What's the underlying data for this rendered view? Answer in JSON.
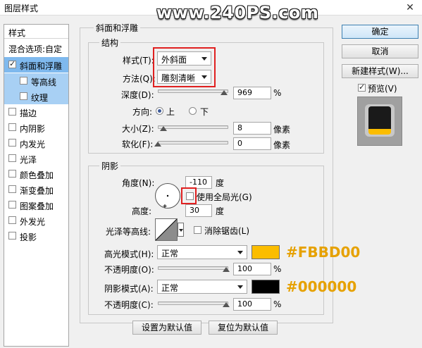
{
  "window": {
    "title": "图层样式",
    "close_glyph": "✕",
    "watermark": "www.240PS.com"
  },
  "left_panel": {
    "header": "样式",
    "blend_options": "混合选项:自定",
    "items": [
      {
        "label": "斜面和浮雕",
        "checked": true
      },
      {
        "label": "等高线",
        "checked": false
      },
      {
        "label": "纹理",
        "checked": false
      },
      {
        "label": "描边",
        "checked": false
      },
      {
        "label": "内阴影",
        "checked": false
      },
      {
        "label": "内发光",
        "checked": false
      },
      {
        "label": "光泽",
        "checked": false
      },
      {
        "label": "颜色叠加",
        "checked": false
      },
      {
        "label": "渐变叠加",
        "checked": false
      },
      {
        "label": "图案叠加",
        "checked": false
      },
      {
        "label": "外发光",
        "checked": false
      },
      {
        "label": "投影",
        "checked": false
      }
    ]
  },
  "bevel": {
    "group_title": "斜面和浮雕",
    "structure": {
      "title": "结构",
      "style_label": "样式(T):",
      "style_value": "外斜面",
      "technique_label": "方法(Q):",
      "technique_value": "雕刻清晰",
      "depth_label": "深度(D):",
      "depth_value": "969",
      "depth_unit": "%",
      "depth_slider": 0.97,
      "direction_label": "方向:",
      "direction_up": "上",
      "direction_down": "下",
      "direction_selected": "上",
      "size_label": "大小(Z):",
      "size_value": "8",
      "size_unit": "像素",
      "size_slider": 0.08,
      "soften_label": "软化(F):",
      "soften_value": "0",
      "soften_unit": "像素",
      "soften_slider": 0.0
    },
    "shading": {
      "title": "阴影",
      "angle_label": "角度(N):",
      "angle_value": "-110",
      "angle_unit": "度",
      "global_light_label": "使用全局光(G)",
      "global_light_checked": false,
      "altitude_label": "高度:",
      "altitude_value": "30",
      "altitude_unit": "度",
      "gloss_label": "光泽等高线:",
      "antialias_label": "消除锯齿(L)",
      "antialias_checked": false,
      "highlight_label": "高光模式(H):",
      "highlight_mode": "正常",
      "highlight_color": "#FBBD00",
      "highlight_opacity_label": "不透明度(O):",
      "highlight_opacity": "100",
      "highlight_opacity_unit": "%",
      "highlight_opacity_slider": 1.0,
      "shadow_label": "阴影模式(A):",
      "shadow_mode": "正常",
      "shadow_color": "#000000",
      "shadow_opacity_label": "不透明度(C):",
      "shadow_opacity": "100",
      "shadow_opacity_unit": "%",
      "shadow_opacity_slider": 1.0
    },
    "make_default": "设置为默认值",
    "reset_default": "复位为默认值"
  },
  "buttons": {
    "ok": "确定",
    "cancel": "取消",
    "new_style": "新建样式(W)...",
    "preview": "预览(V)",
    "preview_checked": true
  },
  "annotations": {
    "highlight_hex": "#FBBD00",
    "shadow_hex": "#000000"
  }
}
